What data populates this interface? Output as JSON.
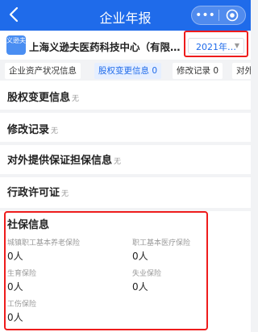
{
  "header": {
    "title": "企业年报",
    "back_icon": "chevron-left-icon",
    "more_icon": "•••"
  },
  "company": {
    "logo_text": "义逊夫",
    "name": "上海义逊夫医药科技中心（有限合伙）",
    "year": "2021年…"
  },
  "tabs": [
    {
      "label": "企业资产状况信息",
      "active": false
    },
    {
      "label": "股权变更信息 0",
      "active": true
    },
    {
      "label": "修改记录 0",
      "active": false
    },
    {
      "label": "对外",
      "active": false
    }
  ],
  "sections": {
    "equity": {
      "title": "股权变更信息",
      "sub": "无"
    },
    "modify": {
      "title": "修改记录",
      "sub": "无"
    },
    "guarantee": {
      "title": "对外提供保证担保信息",
      "sub": "无"
    },
    "license": {
      "title": "行政许可证",
      "sub": "无"
    }
  },
  "social": {
    "title": "社保信息",
    "items": [
      {
        "label": "城镇职工基本养老保险",
        "value": "0人"
      },
      {
        "label": "职工基本医疗保险",
        "value": "0人"
      },
      {
        "label": "生育保险",
        "value": "0人"
      },
      {
        "label": "失业保险",
        "value": "0人"
      },
      {
        "label": "工伤保险",
        "value": "0人"
      }
    ]
  },
  "colors": {
    "brand": "#1f6bea",
    "highlight": "#ee1c1c"
  }
}
